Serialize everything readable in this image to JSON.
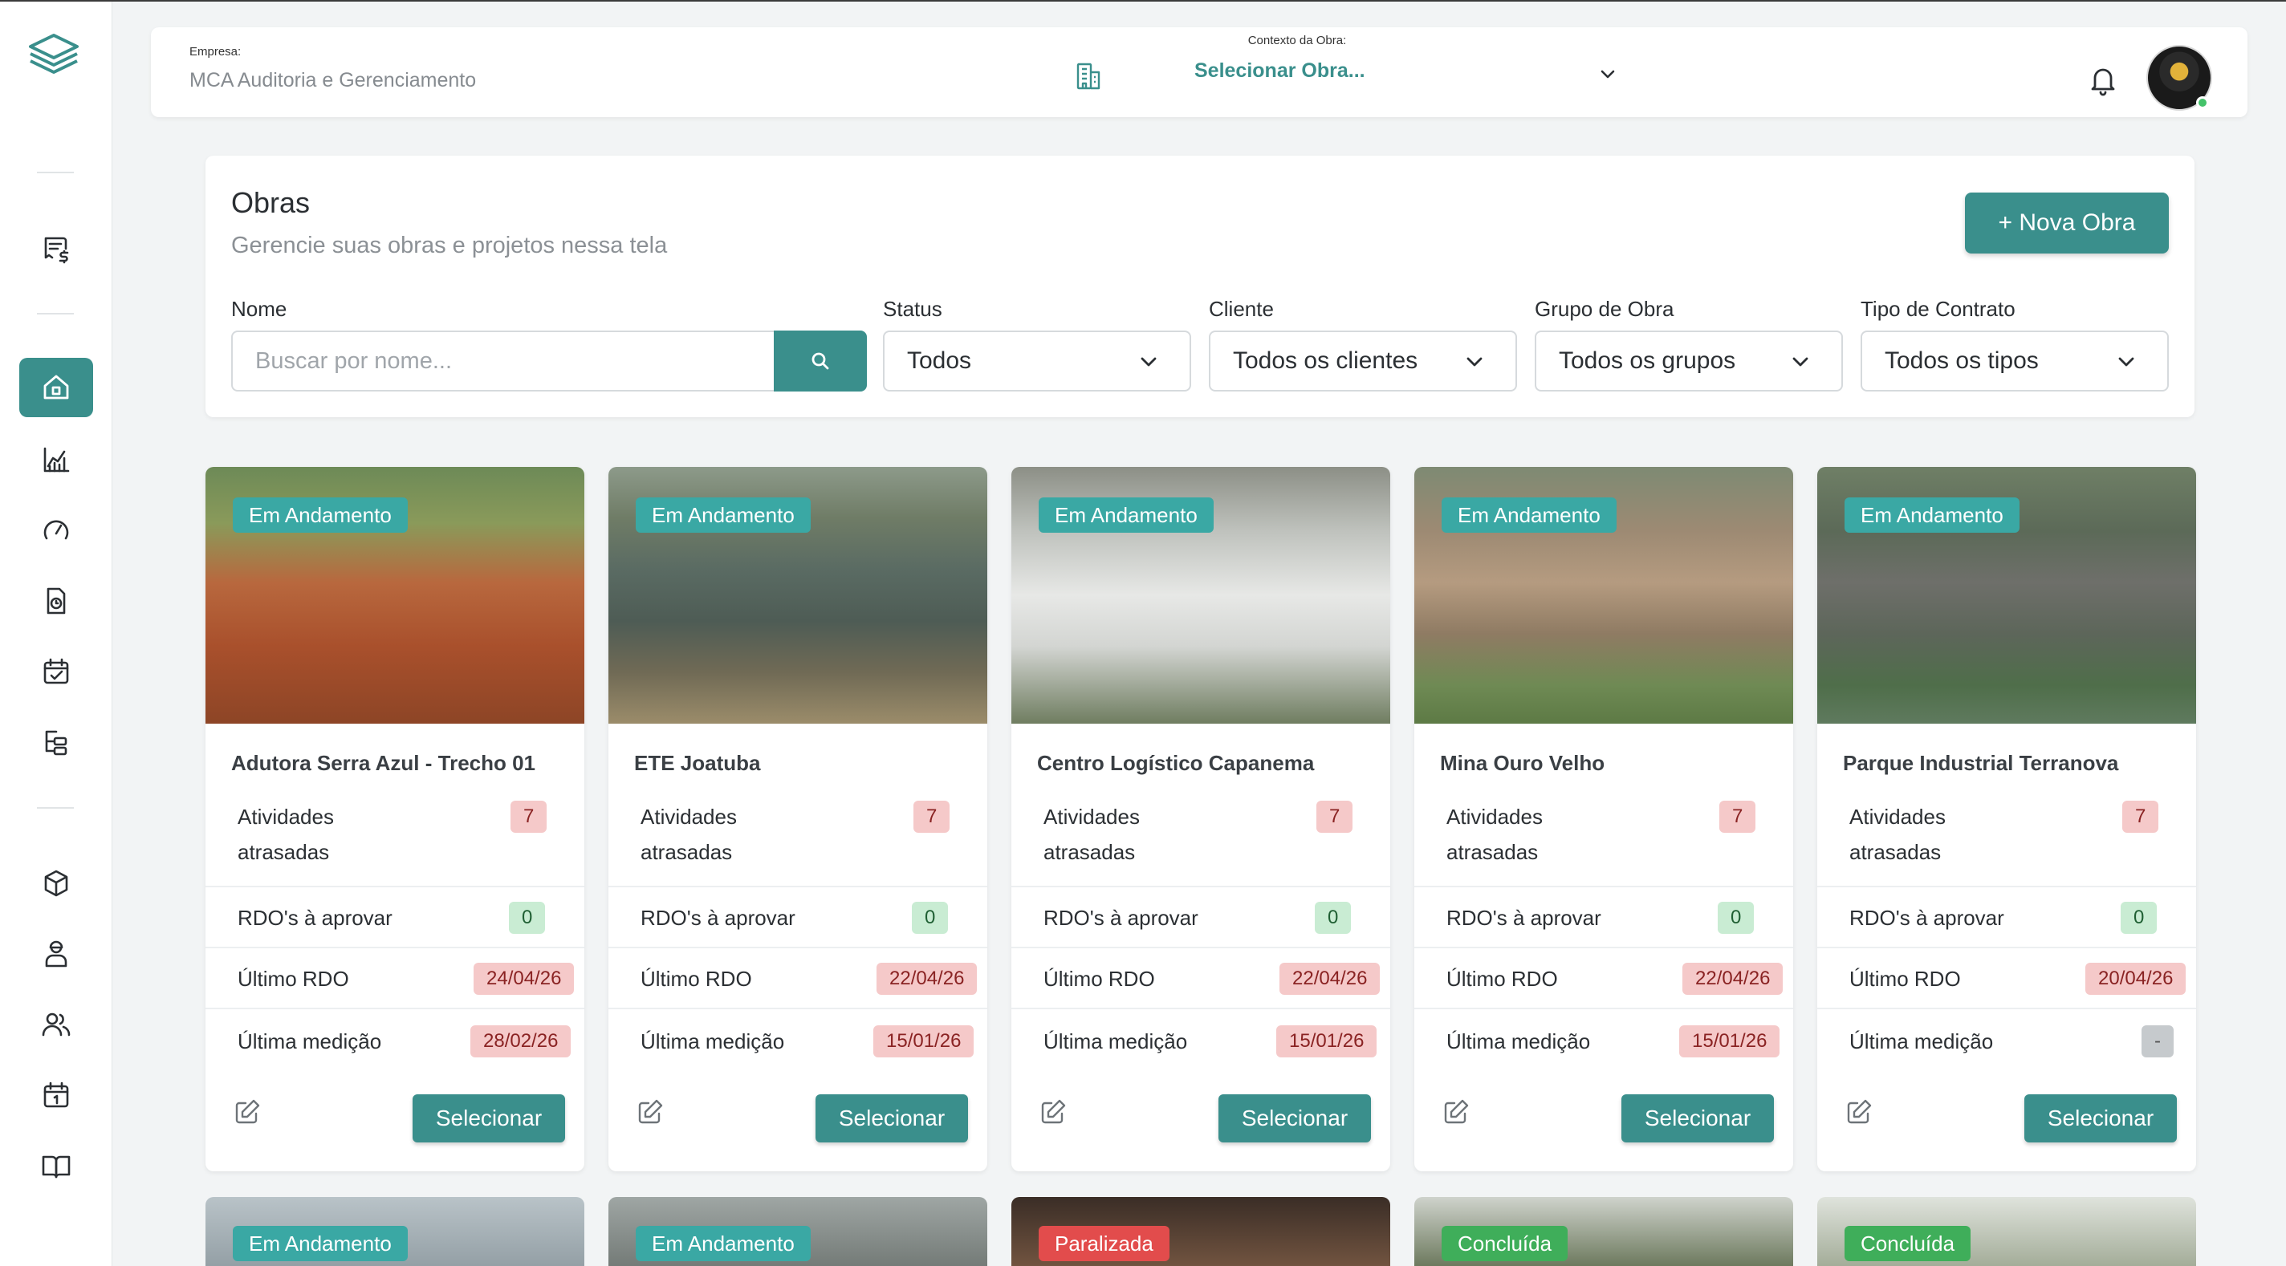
{
  "header": {
    "company_label": "Empresa:",
    "company_name": "MCA Auditoria e Gerenciamento",
    "context_label": "Contexto da Obra:",
    "context_value": "Selecionar Obra..."
  },
  "page": {
    "title": "Obras",
    "subtitle": "Gerencie suas obras e projetos nessa tela",
    "new_button": "+ Nova Obra"
  },
  "filters": {
    "name_label": "Nome",
    "name_placeholder": "Buscar por nome...",
    "status_label": "Status",
    "status_value": "Todos",
    "client_label": "Cliente",
    "client_value": "Todos os clientes",
    "group_label": "Grupo de Obra",
    "group_value": "Todos os grupos",
    "contract_label": "Tipo de Contrato",
    "contract_value": "Todos os tipos"
  },
  "labels": {
    "atividades_line1": "Atividades",
    "atividades_line2": "atrasadas",
    "rdos": "RDO's à aprovar",
    "ultimo_rdo": "Último RDO",
    "ultima_medicao": "Última medição",
    "select_button": "Selecionar"
  },
  "cards": [
    {
      "status": "Em Andamento",
      "title": "Adutora Serra Azul - Trecho 01",
      "atividades": "7",
      "rdos": "0",
      "ultimo_rdo": "24/04/26",
      "ultima_medicao": "28/02/26"
    },
    {
      "status": "Em Andamento",
      "title": "ETE Joatuba",
      "atividades": "7",
      "rdos": "0",
      "ultimo_rdo": "22/04/26",
      "ultima_medicao": "15/01/26"
    },
    {
      "status": "Em Andamento",
      "title": "Centro Logístico Capanema",
      "atividades": "7",
      "rdos": "0",
      "ultimo_rdo": "22/04/26",
      "ultima_medicao": "15/01/26"
    },
    {
      "status": "Em Andamento",
      "title": "Mina Ouro Velho",
      "atividades": "7",
      "rdos": "0",
      "ultimo_rdo": "22/04/26",
      "ultima_medicao": "15/01/26"
    },
    {
      "status": "Em Andamento",
      "title": "Parque Industrial Terranova",
      "atividades": "7",
      "rdos": "0",
      "ultimo_rdo": "20/04/26",
      "ultima_medicao": "-"
    }
  ],
  "cards_row2": [
    {
      "status": "Em Andamento"
    },
    {
      "status": "Em Andamento"
    },
    {
      "status": "Paralizada"
    },
    {
      "status": "Concluída"
    },
    {
      "status": "Concluída"
    }
  ],
  "colors": {
    "accent": "#3a8f8c",
    "badge_in_progress": "#3aa8a4",
    "badge_paused": "#e24c4c",
    "badge_done": "#3fae5a"
  }
}
